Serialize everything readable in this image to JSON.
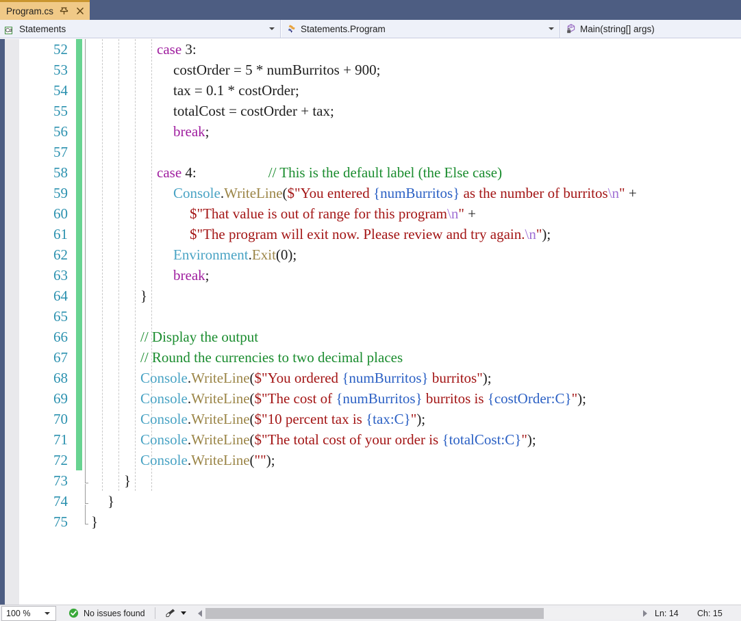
{
  "tab": {
    "label": "Program.cs",
    "pin_icon": "pin-icon",
    "close_icon": "close-icon"
  },
  "nav_bar": {
    "project": {
      "icon": "csharp-project-icon",
      "text": "Statements"
    },
    "type": {
      "icon": "class-icon",
      "text": "Statements.Program"
    },
    "member": {
      "icon": "method-private-icon",
      "text": "Main(string[] args)"
    }
  },
  "editor": {
    "first_line_number": 52,
    "line_numbers": [
      52,
      53,
      54,
      55,
      56,
      57,
      58,
      59,
      60,
      61,
      62,
      63,
      64,
      65,
      66,
      67,
      68,
      69,
      70,
      71,
      72,
      73,
      74,
      75
    ],
    "lines": [
      {
        "n": 52,
        "indent": 4,
        "tokens": [
          {
            "t": "case ",
            "c": "t-kw"
          },
          {
            "t": "3",
            "c": "t-num"
          },
          {
            "t": ":",
            "c": "t-plain"
          }
        ]
      },
      {
        "n": 53,
        "indent": 5,
        "tokens": [
          {
            "t": "costOrder = ",
            "c": "t-plain"
          },
          {
            "t": "5",
            "c": "t-num"
          },
          {
            "t": " * numBurritos + ",
            "c": "t-plain"
          },
          {
            "t": "900",
            "c": "t-num"
          },
          {
            "t": ";",
            "c": "t-plain"
          }
        ]
      },
      {
        "n": 54,
        "indent": 5,
        "tokens": [
          {
            "t": "tax = ",
            "c": "t-plain"
          },
          {
            "t": "0.1",
            "c": "t-num"
          },
          {
            "t": " * costOrder;",
            "c": "t-plain"
          }
        ]
      },
      {
        "n": 55,
        "indent": 5,
        "tokens": [
          {
            "t": "totalCost = costOrder + tax;",
            "c": "t-plain"
          }
        ]
      },
      {
        "n": 56,
        "indent": 5,
        "tokens": [
          {
            "t": "break",
            "c": "t-kw"
          },
          {
            "t": ";",
            "c": "t-plain"
          }
        ]
      },
      {
        "n": 57,
        "indent": 0,
        "tokens": []
      },
      {
        "n": 58,
        "indent": 4,
        "tokens": [
          {
            "t": "case ",
            "c": "t-kw"
          },
          {
            "t": "4",
            "c": "t-num"
          },
          {
            "t": ":",
            "c": "t-plain"
          },
          {
            "t": "                    ",
            "c": "t-plain"
          },
          {
            "t": "// This is the default label (the Else case)",
            "c": "t-com"
          }
        ]
      },
      {
        "n": 59,
        "indent": 5,
        "tokens": [
          {
            "t": "Console",
            "c": "t-type"
          },
          {
            "t": ".",
            "c": "t-plain"
          },
          {
            "t": "WriteLine",
            "c": "t-method"
          },
          {
            "t": "(",
            "c": "t-plain"
          },
          {
            "t": "$\"You entered ",
            "c": "t-str"
          },
          {
            "t": "{numBurritos}",
            "c": "t-interp"
          },
          {
            "t": " as the number of burritos",
            "c": "t-str"
          },
          {
            "t": "\\n",
            "c": "t-esc"
          },
          {
            "t": "\"",
            "c": "t-str"
          },
          {
            "t": " +",
            "c": "t-plain"
          }
        ]
      },
      {
        "n": 60,
        "indent": 6,
        "tokens": [
          {
            "t": "$\"That value is out of range for this program",
            "c": "t-str"
          },
          {
            "t": "\\n",
            "c": "t-esc"
          },
          {
            "t": "\"",
            "c": "t-str"
          },
          {
            "t": " +",
            "c": "t-plain"
          }
        ]
      },
      {
        "n": 61,
        "indent": 6,
        "tokens": [
          {
            "t": "$\"The program will exit now. Please review and try again.",
            "c": "t-str"
          },
          {
            "t": "\\n",
            "c": "t-esc"
          },
          {
            "t": "\"",
            "c": "t-str"
          },
          {
            "t": ");",
            "c": "t-plain"
          }
        ]
      },
      {
        "n": 62,
        "indent": 5,
        "tokens": [
          {
            "t": "Environment",
            "c": "t-type"
          },
          {
            "t": ".",
            "c": "t-plain"
          },
          {
            "t": "Exit",
            "c": "t-method"
          },
          {
            "t": "(",
            "c": "t-plain"
          },
          {
            "t": "0",
            "c": "t-num"
          },
          {
            "t": ");",
            "c": "t-plain"
          }
        ]
      },
      {
        "n": 63,
        "indent": 5,
        "tokens": [
          {
            "t": "break",
            "c": "t-kw"
          },
          {
            "t": ";",
            "c": "t-plain"
          }
        ]
      },
      {
        "n": 64,
        "indent": 3,
        "tokens": [
          {
            "t": "}",
            "c": "t-brace"
          }
        ]
      },
      {
        "n": 65,
        "indent": 0,
        "tokens": []
      },
      {
        "n": 66,
        "indent": 3,
        "tokens": [
          {
            "t": "// Display the output",
            "c": "t-com"
          }
        ]
      },
      {
        "n": 67,
        "indent": 3,
        "tokens": [
          {
            "t": "// Round the currencies to two decimal places",
            "c": "t-com"
          }
        ]
      },
      {
        "n": 68,
        "indent": 3,
        "tokens": [
          {
            "t": "Console",
            "c": "t-type"
          },
          {
            "t": ".",
            "c": "t-plain"
          },
          {
            "t": "WriteLine",
            "c": "t-method"
          },
          {
            "t": "(",
            "c": "t-plain"
          },
          {
            "t": "$\"You ordered ",
            "c": "t-str"
          },
          {
            "t": "{numBurritos}",
            "c": "t-interp"
          },
          {
            "t": " burritos\"",
            "c": "t-str"
          },
          {
            "t": ");",
            "c": "t-plain"
          }
        ]
      },
      {
        "n": 69,
        "indent": 3,
        "tokens": [
          {
            "t": "Console",
            "c": "t-type"
          },
          {
            "t": ".",
            "c": "t-plain"
          },
          {
            "t": "WriteLine",
            "c": "t-method"
          },
          {
            "t": "(",
            "c": "t-plain"
          },
          {
            "t": "$\"The cost of ",
            "c": "t-str"
          },
          {
            "t": "{numBurritos}",
            "c": "t-interp"
          },
          {
            "t": " burritos is ",
            "c": "t-str"
          },
          {
            "t": "{costOrder:C}",
            "c": "t-interp"
          },
          {
            "t": "\"",
            "c": "t-str"
          },
          {
            "t": ");",
            "c": "t-plain"
          }
        ]
      },
      {
        "n": 70,
        "indent": 3,
        "tokens": [
          {
            "t": "Console",
            "c": "t-type"
          },
          {
            "t": ".",
            "c": "t-plain"
          },
          {
            "t": "WriteLine",
            "c": "t-method"
          },
          {
            "t": "(",
            "c": "t-plain"
          },
          {
            "t": "$\"10 percent tax is ",
            "c": "t-str"
          },
          {
            "t": "{tax:C}",
            "c": "t-interp"
          },
          {
            "t": "\"",
            "c": "t-str"
          },
          {
            "t": ");",
            "c": "t-plain"
          }
        ]
      },
      {
        "n": 71,
        "indent": 3,
        "tokens": [
          {
            "t": "Console",
            "c": "t-type"
          },
          {
            "t": ".",
            "c": "t-plain"
          },
          {
            "t": "WriteLine",
            "c": "t-method"
          },
          {
            "t": "(",
            "c": "t-plain"
          },
          {
            "t": "$\"The total cost of your order is ",
            "c": "t-str"
          },
          {
            "t": "{totalCost:C}",
            "c": "t-interp"
          },
          {
            "t": "\"",
            "c": "t-str"
          },
          {
            "t": ");",
            "c": "t-plain"
          }
        ]
      },
      {
        "n": 72,
        "indent": 3,
        "tokens": [
          {
            "t": "Console",
            "c": "t-type"
          },
          {
            "t": ".",
            "c": "t-plain"
          },
          {
            "t": "WriteLine",
            "c": "t-method"
          },
          {
            "t": "(",
            "c": "t-plain"
          },
          {
            "t": "\"\"",
            "c": "t-str"
          },
          {
            "t": ");",
            "c": "t-plain"
          }
        ]
      },
      {
        "n": 73,
        "indent": 2,
        "tokens": [
          {
            "t": "}",
            "c": "t-brace"
          }
        ]
      },
      {
        "n": 74,
        "indent": 1,
        "tokens": [
          {
            "t": "}",
            "c": "t-brace"
          }
        ]
      },
      {
        "n": 75,
        "indent": 0,
        "tokens": [
          {
            "t": "}",
            "c": "t-brace"
          }
        ]
      }
    ],
    "change_bar_color": "#68d391",
    "indent_guide_count": 5
  },
  "status_bar": {
    "zoom": "100 %",
    "issues": "No issues found",
    "issues_icon": "check-circle-icon",
    "feedback_icon": "feedback-brush-icon",
    "line_position": "Ln: 14",
    "char_position": "Ch: 15"
  },
  "colors": {
    "tab_active_bg": "#f0c987",
    "tab_strip_bg": "#4d5d82",
    "nav_bar_bg": "#eef1f9",
    "status_bar_bg": "#efeff2",
    "line_number": "#2b91af",
    "keyword": "#a020a0",
    "type": "#49a3c4",
    "method": "#9b8547",
    "string": "#a31515",
    "interpolation": "#2b60c4",
    "escape": "#9f6fd4",
    "comment": "#1a8c2e",
    "change_bar": "#68d391"
  }
}
